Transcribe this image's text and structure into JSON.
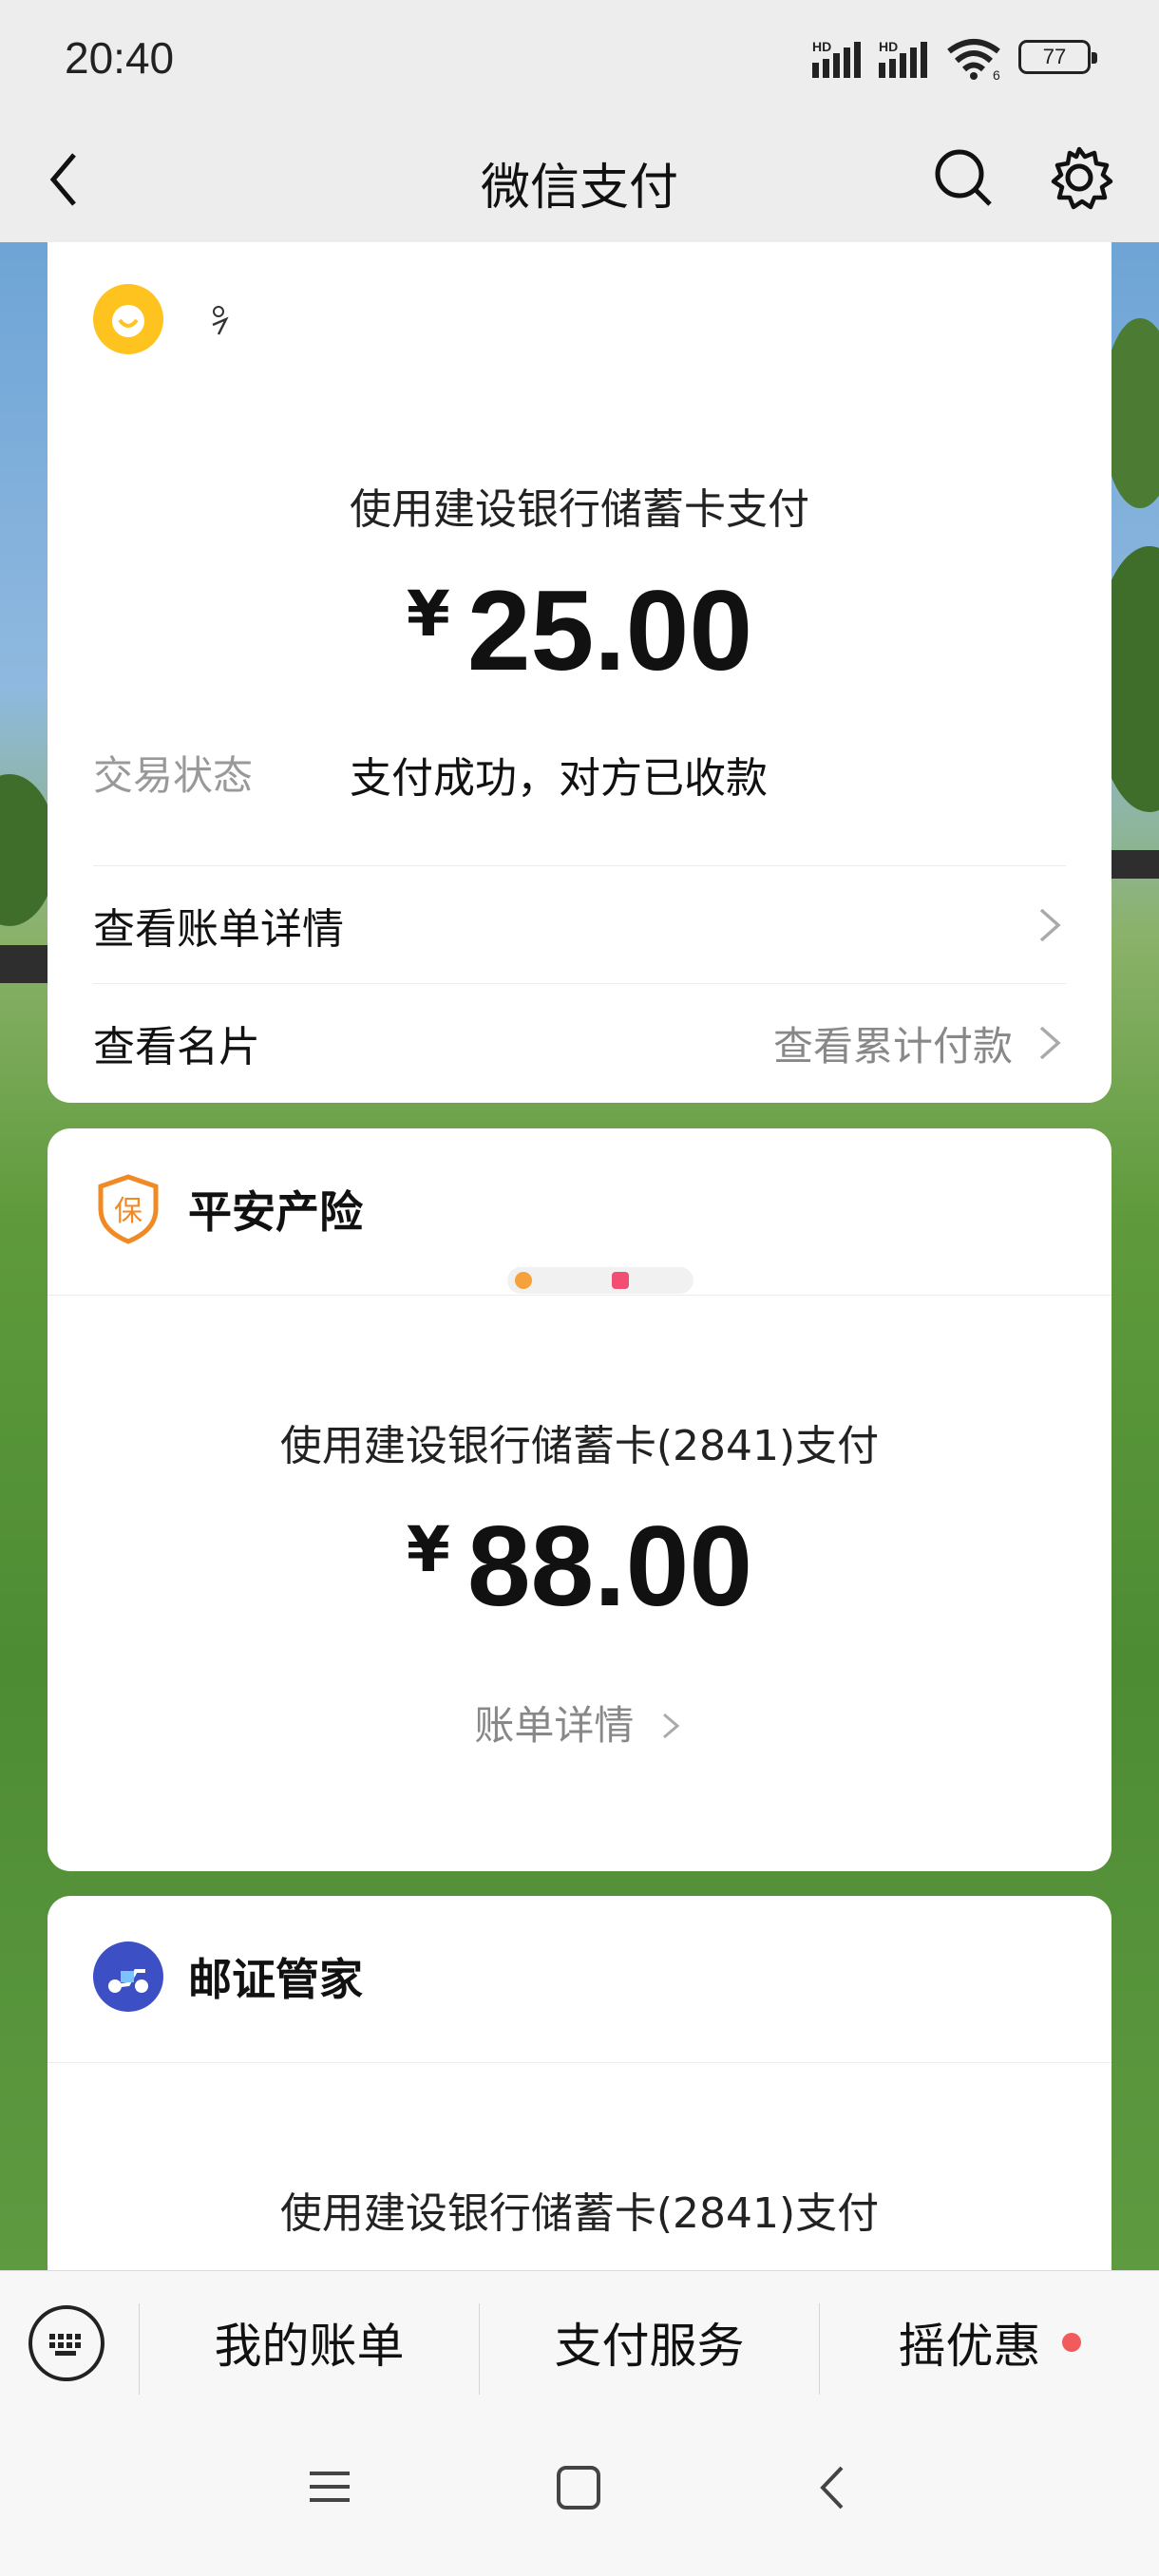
{
  "status_bar": {
    "time": "20:40",
    "battery": "77",
    "signal1_label": "HD",
    "signal2_label": "HD",
    "wifi_badge": "6"
  },
  "header": {
    "title": "微信支付"
  },
  "cards": [
    {
      "merchant": "",
      "pay_method": "使用建设银行储蓄卡支付",
      "currency": "¥",
      "amount": "25.00",
      "status_label": "交易状态",
      "status_value": "支付成功，对方已收款",
      "rows": [
        {
          "label": "查看账单详情",
          "right": ""
        },
        {
          "label": "查看名片",
          "right": "查看累计付款"
        }
      ]
    },
    {
      "merchant": "平安产险",
      "logo_char": "保",
      "pay_method": "使用建设银行储蓄卡(2841)支付",
      "currency": "¥",
      "amount": "88.00",
      "detail_link": "账单详情"
    },
    {
      "merchant": "邮证管家",
      "pay_method": "使用建设银行储蓄卡(2841)支付"
    }
  ],
  "bottom_tabs": [
    {
      "label": "我的账单"
    },
    {
      "label": "支付服务"
    },
    {
      "label": "摇优惠"
    }
  ],
  "colors": {
    "accent_red": "#f25b5b",
    "safety_orange": "#f08a24",
    "wechat_yellow": "#ffc31f"
  }
}
